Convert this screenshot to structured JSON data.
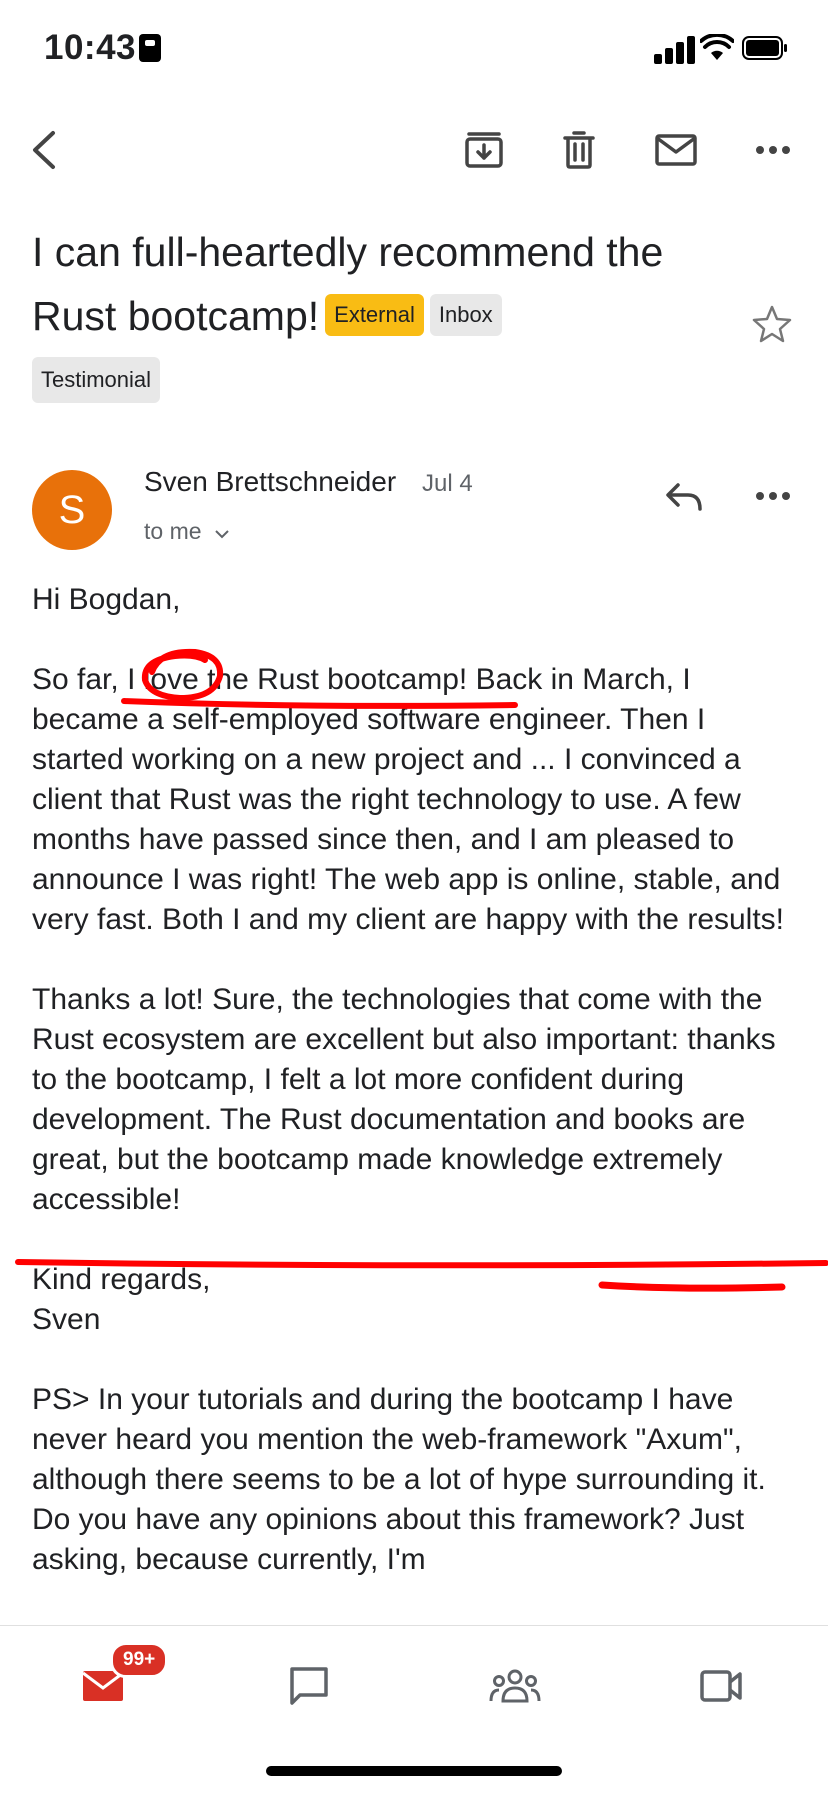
{
  "status": {
    "time": "10:43"
  },
  "email": {
    "subject": "I can full-heartedly recommend the Rust bootcamp!",
    "labels": [
      "External",
      "Inbox",
      "Testimonial"
    ],
    "sender_initial": "S",
    "sender": "Sven Brettschneider",
    "date": "Jul 4",
    "recipient": "to me",
    "greeting": "Hi Bogdan,",
    "para1_start": "So far, ",
    "para1_highlight": "I love the Rust bootcamp!",
    "para1_rest": " Back in March, I became a self-employed software engineer. Then I started working on a new project and ... I convinced a client that Rust was the right technology to use. A few months have passed since then, and I am pleased to announce I was right! The web app is online, stable, and very fast. Both I and my client are happy with the results!",
    "para2_start": "Thanks a lot! Sure, the technologies that come with the Rust ecosystem are excellent but also important: thanks to the bootcamp, I felt a lot more confident during development. The Rust documentation and books are great, but the ",
    "para2_highlight": "bootcamp made knowledge extremely accessible!",
    "closing1": "Kind regards,",
    "closing2": "Sven",
    "ps": "PS> In your tutorials and during the bootcamp I have never heard you mention the web-framework \"Axum\", although there seems to be a lot of hype surrounding it. Do you have any opinions about this framework? Just asking, because currently, I'm"
  },
  "nav": {
    "mail_badge": "99+"
  },
  "colors": {
    "accent_red": "#d93025",
    "annotation_red": "#ff0000",
    "external_chip": "#f9bc14",
    "avatar": "#e8710a"
  },
  "icons": [
    "back-arrow-icon",
    "archive-icon",
    "trash-icon",
    "mail-icon",
    "more-icon",
    "star-icon",
    "reply-icon",
    "chevron-down-icon",
    "chat-icon",
    "spaces-icon",
    "video-icon"
  ]
}
